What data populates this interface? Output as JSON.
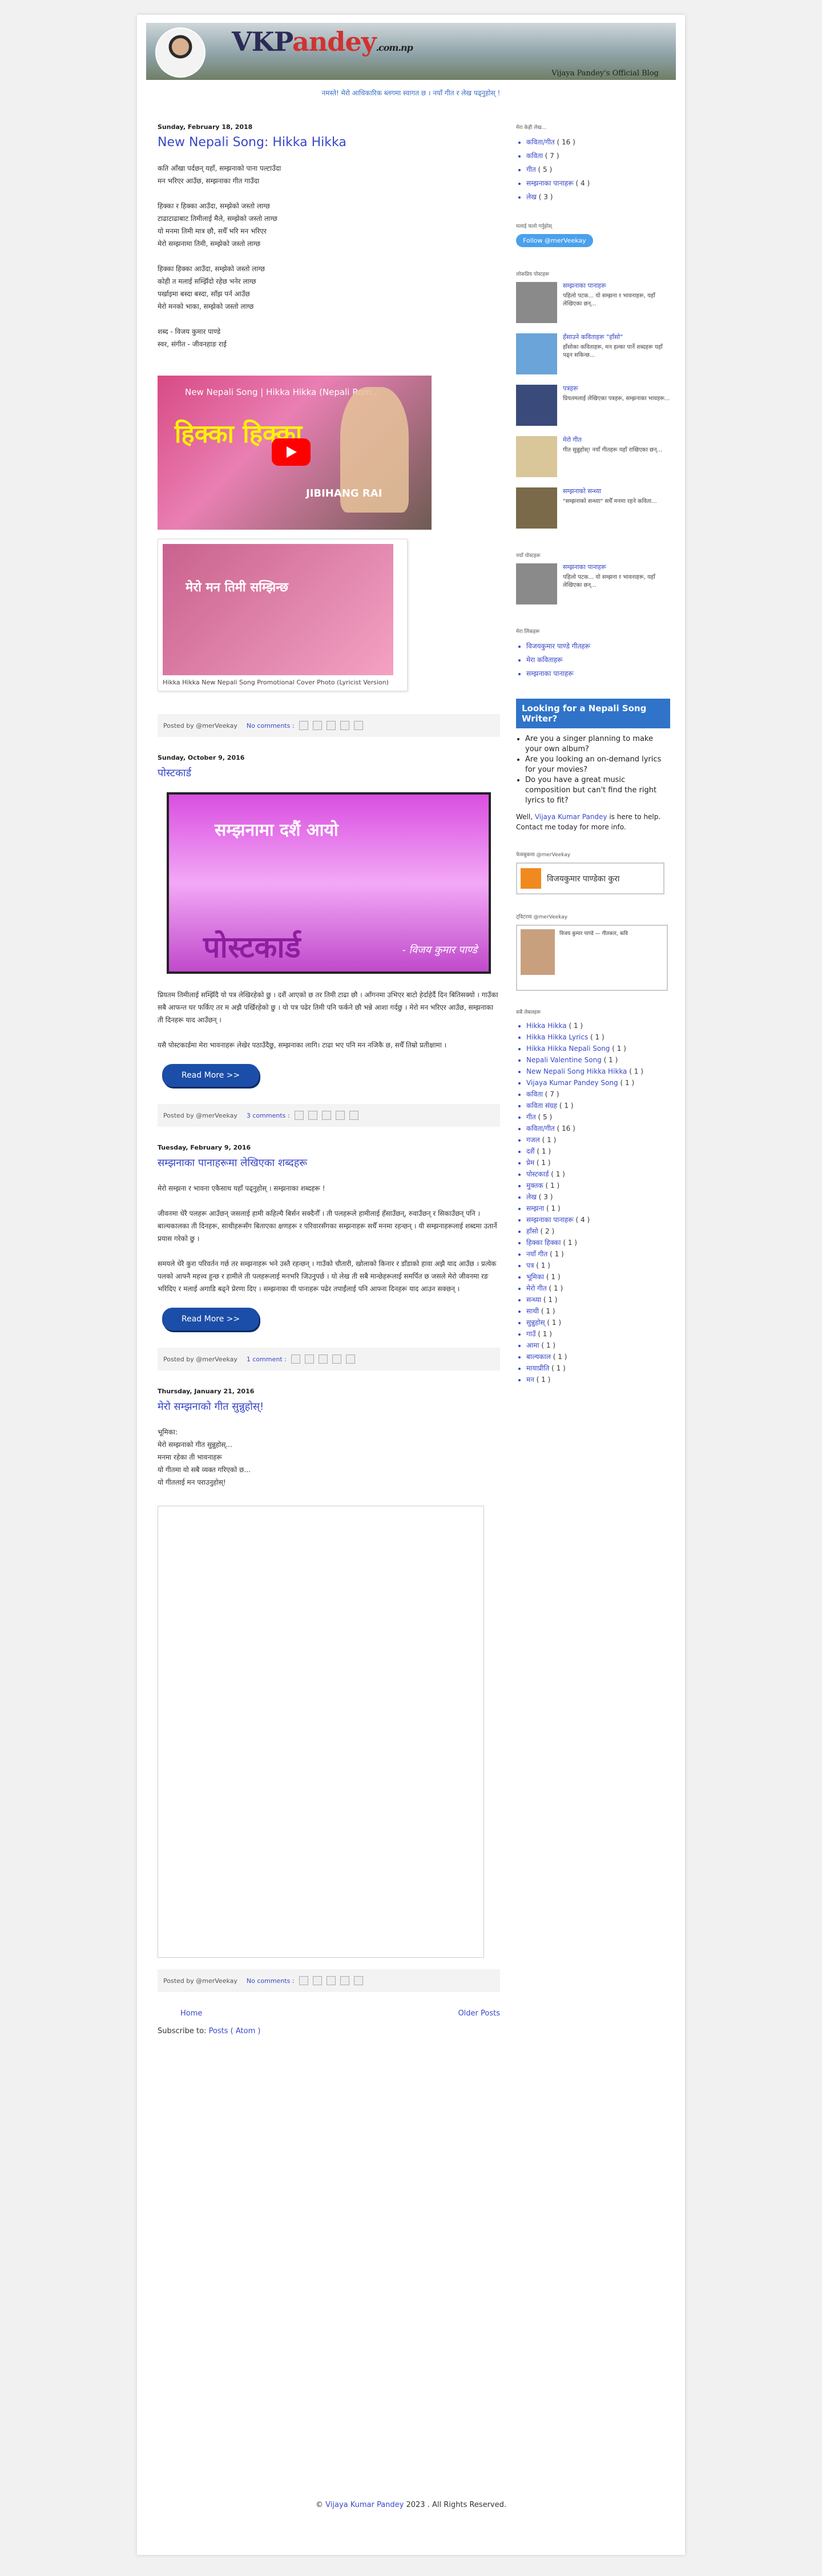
{
  "header": {
    "logo_main": "VKP",
    "logo_p": "andey",
    "logo_tld": ".com.np",
    "tagline": "Vijaya Pandey's Official Blog"
  },
  "marquee": "नमस्ते! मेरो आधिकारिक ब्लगमा स्वागत छ । नयाँ गीत र लेख पढ्नुहोस् !",
  "posts": [
    {
      "date": "Sunday, February 18, 2018",
      "title": "New Nepali Song: Hikka Hikka",
      "paras": [
        "कति आँखा पर्दछन् यहाँ, सम्झनाको पाना पल्टाउँदा\nमन भरिएर आउँछ, सम्झनाका गीत गाउँदा",
        "हिक्का र हिक्का आउँदा, सम्झेको जस्तो लाग्छ\nटाढाटाढाबाट तिमीलाई मैले, सम्झेको जस्तो लाग्छ\nयो मनमा तिमी मात्र छौ, सधैँ भरि मन भरिएर\nमेरो सम्झनामा तिमी, सम्झेको जस्तो लाग्छ",
        "हिक्का हिक्का आउँदा, सम्झेको जस्तो लाग्छ\nकोही त मलाई सम्झिँदो रहेछ भनेर लाग्छ\nपर्खाइमा बस्दा बस्दा, साँझ पर्न आउँछ\nमेरो मनको भाका, सम्झेको जस्तो लाग्छ",
        "शब्द - विजय कुमार पाण्डे\nस्वर, संगीत - जीवनहाङ राई"
      ],
      "video_title": "New Nepali Song | Hikka Hikka (Nepali Rom...",
      "video_big": "हिक्का हिक्का",
      "video_name": "JIBIHANG RAI",
      "image_text": "मेरो मन तिमी सम्झिन्छ",
      "caption": "Hikka Hikka New Nepali Song Promotional Cover Photo (Lyricist Version)",
      "posted_by": "Posted by @merVeekay",
      "comments": "No comments :"
    },
    {
      "date": "Sunday, October 9, 2016",
      "title": "पोस्टकार्ड",
      "banner_top": "सम्झनामा दशैं आयो",
      "banner_main": "पोस्टकार्ड",
      "banner_author": "- विजय कुमार पाण्डे",
      "paras": [
        "प्रियतम तिमीलाई सम्झिँदै यो पत्र लेखिरहेको छु । दशैं आएको छ तर तिमी टाढा छौ । आँगनमा उभिएर बाटो हेर्दाहेर्दै दिन बितिसक्यो । गाउँका सबै आफन्त घर फर्किए तर म अझै पर्खिरहेको छु । यो पत्र पढेर तिमी पनि फर्कने छौ भन्ने आशा गर्दछु । मेरो मन भरिएर आउँछ, सम्झनाका ती दिनहरू याद आउँछन् ।",
        "यसै पोस्टकार्डमा मेरा भावनाहरू लेखेर पठाउँदैछु, सम्झनाका लागि। टाढा भए पनि मन नजिकै छ, सधैँ तिम्रो प्रतीक्षामा ।"
      ],
      "read_more": "Read More >>",
      "posted_by": "Posted by @merVeekay",
      "comments": "3 comments :"
    },
    {
      "date": "Tuesday, February 9, 2016",
      "title": "सम्झनाका पानाहरूमा लेखिएका शब्दहरू",
      "paras": [
        "मेरो सम्झना र भावना एकैसाथ यहाँ पढ्नुहोस् । सम्झनाका शब्दहरू !",
        "जीवनमा धेरै पलहरू आउँछन् जसलाई हामी कहिल्यै बिर्सन सक्दैनौँ । ती पलहरूले हामीलाई हँसाउँछन्, रुवाउँछन् र सिकाउँछन् पनि । बाल्यकालका ती दिनहरू, साथीहरूसँग बिताएका क्षणहरू र परिवारसँगका सम्झनाहरू सधैँ मनमा रहन्छन् । यी सम्झनाहरूलाई शब्दमा उतार्ने प्रयास गरेको छु ।",
        "समयले धेरै कुरा परिवर्तन गर्छ तर सम्झनाहरू भने उस्तै रहन्छन् । गाउँको चौतारी, खोलाको किनार र डाँडाको हावा अझै याद आउँछ । प्रत्येक पलको आफ्नै महत्त्व हुन्छ र हामीले ती पलहरूलाई मनभरि जिउनुपर्छ । यो लेख ती सबै मान्छेहरूलाई समर्पित छ जसले मेरो जीवनमा रङ भरिदिए र मलाई अगाडि बढ्ने प्रेरणा दिए । सम्झनाका यी पानाहरू पढेर तपाईंलाई पनि आफ्ना दिनहरू याद आउन सक्छन् ।"
      ],
      "read_more": "Read More >>",
      "posted_by": "Posted by @merVeekay",
      "comments": "1 comment :"
    },
    {
      "date": "Thursday, January 21, 2016",
      "title": "मेरो सम्झनाको गीत सुन्नुहोस्!",
      "paras": [
        "भूमिका:\nमेरो सम्झनाको गीत सुन्नुहोस्...\nमनमा रहेका ती भावनाहरू\nयो गीतमा यो सबै व्यक्त गरिएको छ...\nयो गीतलाई मन पराउनुहोस्!"
      ],
      "posted_by": "Posted by @merVeekay",
      "comments": "No comments :"
    }
  ],
  "pager": {
    "home": "Home",
    "older": "Older Posts"
  },
  "subscribe": {
    "label": "Subscribe to:",
    "link": "Posts ( Atom )"
  },
  "copyright": {
    "prefix": "© ",
    "name": "Vijaya Kumar Pandey",
    "suffix": " 2023 . All Rights Reserved."
  },
  "sidebar": {
    "labels_title": "मेरा केही लेख...",
    "labels": [
      {
        "name": "कविता/गीत",
        "count": "( 16 )"
      },
      {
        "name": "कविता",
        "count": "( 7 )"
      },
      {
        "name": "गीत",
        "count": "( 5 )"
      },
      {
        "name": "सम्झनाका पानाहरू",
        "count": "( 4 )"
      },
      {
        "name": "लेख",
        "count": "( 3 )"
      }
    ],
    "follow_title": "मलाई फलो गर्नुहोस्",
    "follow_button": "Follow @merVeekay",
    "popular_title": "लोकप्रिय पोस्टहरू",
    "popular": [
      {
        "title": "सम्झनाका पानाहरू",
        "desc": "पहिलो पटक... यो सम्झना र भावनाहरू, यहाँ लेखिएका छन्..."
      },
      {
        "title": "हँसाउने कविताहरू \"हाँसो\"",
        "desc": "हाँसोका कविताहरू, मन हल्का पार्ने शब्दहरू यहाँ पढ्न सकिन्छ..."
      },
      {
        "title": "पत्रहरू",
        "desc": "प्रियतमलाई लेखिएका पत्रहरू, सम्झनाका भावहरू..."
      },
      {
        "title": "मेरो गीत",
        "desc": "गीत सुन्नुहोस्! नयाँ गीतहरू यहाँ राखिएका छन्..."
      },
      {
        "title": "सम्झनाको सन्ध्या",
        "desc": "\"सम्झनाको सन्ध्या\" सधैँ मनमा रहने कविता..."
      }
    ],
    "recent_title": "नयाँ पोस्टहरू",
    "recent": [
      {
        "title": "सम्झनाका पानाहरू",
        "desc": "पहिलो पटक... यो सम्झना र भावनाहरू, यहाँ लेखिएका छन्..."
      }
    ],
    "links_title": "मेरा लिंकहरू",
    "links": [
      "विजयकुमार पाण्डे गीतहरू",
      "मेरा कविताहरू",
      "सम्झनाका पानाहरू"
    ],
    "ad_title": "Looking for a Nepali Song Writer?",
    "ad_points": [
      "Are you a singer planning to make your own album?",
      "Are you looking an on-demand lyrics for your movies?",
      "Do you have a great music composition but can't find the right lyrics to fit?"
    ],
    "ad_well": "Well, ",
    "ad_name": "Vijaya Kumar Pandey",
    "ad_tail": " is here to help.",
    "ad_contact": "Contact me today for more info.",
    "badge_title": "फेसबुकमा @merVeekay",
    "badge_text": "विजयकुमार पाण्डेका कुरा",
    "twitter_title": "ट्विटरमा @merVeekay",
    "profile_text": "विजय कुमार पाण्डे — गीतकार, कवि",
    "tags_title": "सबै लेबलहरू",
    "tags": [
      {
        "name": "Hikka Hikka",
        "count": "( 1 )"
      },
      {
        "name": "Hikka Hikka Lyrics",
        "count": "( 1 )"
      },
      {
        "name": "Hikka Hikka Nepali Song",
        "count": "( 1 )"
      },
      {
        "name": "Nepali Valentine Song",
        "count": "( 1 )"
      },
      {
        "name": "New Nepali Song Hikka Hikka",
        "count": "( 1 )"
      },
      {
        "name": "Vijaya Kumar Pandey Song",
        "count": "( 1 )"
      },
      {
        "name": "कविता",
        "count": "( 7 )"
      },
      {
        "name": "कविता संग्रह",
        "count": "( 1 )"
      },
      {
        "name": "गीत",
        "count": "( 5 )"
      },
      {
        "name": "कविता/गीत",
        "count": "( 16 )"
      },
      {
        "name": "गजल",
        "count": "( 1 )"
      },
      {
        "name": "दशैं",
        "count": "( 1 )"
      },
      {
        "name": "प्रेम",
        "count": "( 1 )"
      },
      {
        "name": "पोस्टकार्ड",
        "count": "( 1 )"
      },
      {
        "name": "मुक्तक",
        "count": "( 1 )"
      },
      {
        "name": "लेख",
        "count": "( 3 )"
      },
      {
        "name": "सम्झना",
        "count": "( 1 )"
      },
      {
        "name": "सम्झनाका पानाहरू",
        "count": "( 4 )"
      },
      {
        "name": "हाँसो",
        "count": "( 2 )"
      },
      {
        "name": "हिक्का हिक्का",
        "count": "( 1 )"
      },
      {
        "name": "नयाँ गीत",
        "count": "( 1 )"
      },
      {
        "name": "पत्र",
        "count": "( 1 )"
      },
      {
        "name": "भूमिका",
        "count": "( 1 )"
      },
      {
        "name": "मेरो गीत",
        "count": "( 1 )"
      },
      {
        "name": "सन्ध्या",
        "count": "( 1 )"
      },
      {
        "name": "साथी",
        "count": "( 1 )"
      },
      {
        "name": "सुन्नुहोस्",
        "count": "( 1 )"
      },
      {
        "name": "गाउँ",
        "count": "( 1 )"
      },
      {
        "name": "आमा",
        "count": "( 1 )"
      },
      {
        "name": "बाल्यकाल",
        "count": "( 1 )"
      },
      {
        "name": "मायाप्रीति",
        "count": "( 1 )"
      },
      {
        "name": "मन",
        "count": "( 1 )"
      }
    ]
  }
}
